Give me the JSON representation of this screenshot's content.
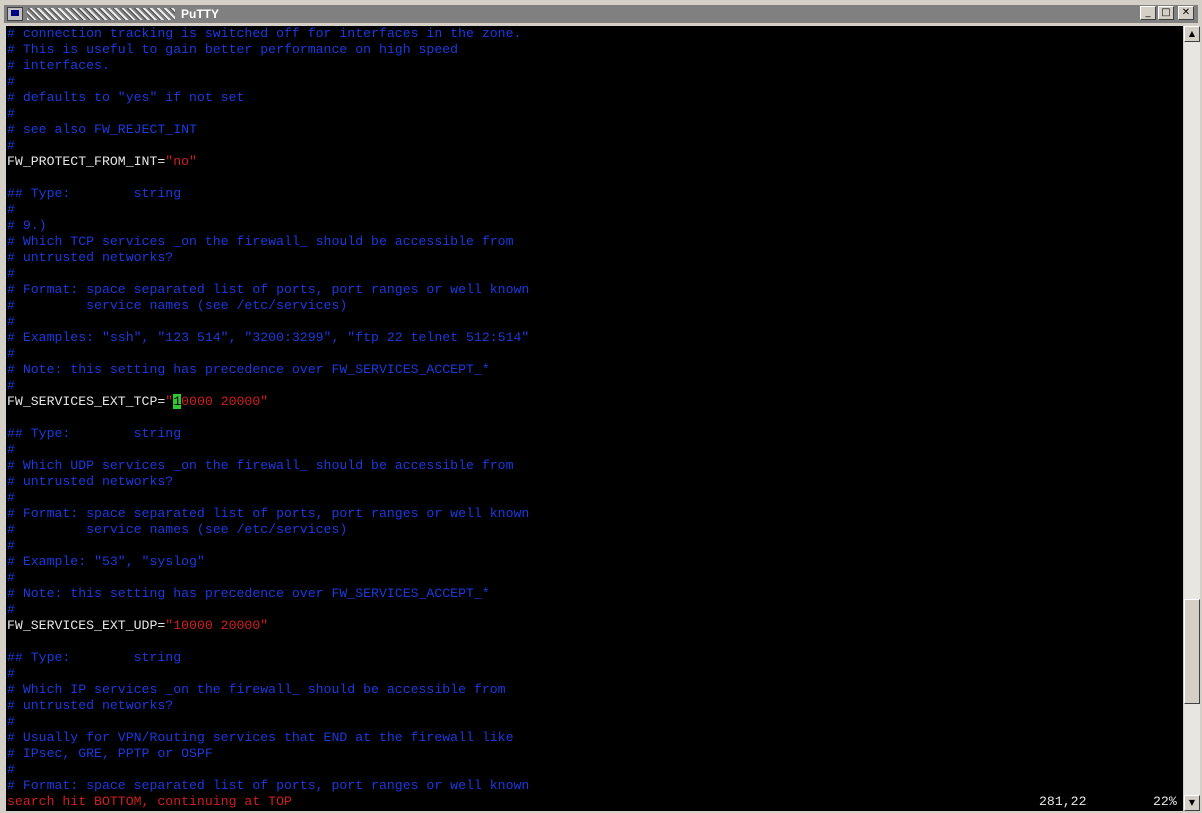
{
  "window": {
    "title": "PuTTY",
    "minimize": "_",
    "maximize": "□",
    "close": "✕"
  },
  "terminal": {
    "lines": [
      [
        {
          "t": "# connection tracking is switched off for interfaces in the zone.",
          "c": "c"
        }
      ],
      [
        {
          "t": "# This is useful to gain better performance on high speed",
          "c": "c"
        }
      ],
      [
        {
          "t": "# interfaces.",
          "c": "c"
        }
      ],
      [
        {
          "t": "#",
          "c": "c"
        }
      ],
      [
        {
          "t": "# defaults to \"yes\" if not set",
          "c": "c"
        }
      ],
      [
        {
          "t": "#",
          "c": "c"
        }
      ],
      [
        {
          "t": "# see also FW_REJECT_INT",
          "c": "c"
        }
      ],
      [
        {
          "t": "#",
          "c": "c"
        }
      ],
      [
        {
          "t": "FW_PROTECT_FROM_INT=",
          "c": "w"
        },
        {
          "t": "\"no\"",
          "c": "r"
        }
      ],
      [],
      [
        {
          "t": "## Type:        string",
          "c": "c"
        }
      ],
      [
        {
          "t": "#",
          "c": "c"
        }
      ],
      [
        {
          "t": "# 9.)",
          "c": "c"
        }
      ],
      [
        {
          "t": "# Which TCP services _on the firewall_ should be accessible from",
          "c": "c"
        }
      ],
      [
        {
          "t": "# untrusted networks?",
          "c": "c"
        }
      ],
      [
        {
          "t": "#",
          "c": "c"
        }
      ],
      [
        {
          "t": "# Format: space separated list of ports, port ranges or well known",
          "c": "c"
        }
      ],
      [
        {
          "t": "#         service names (see /etc/services)",
          "c": "c"
        }
      ],
      [
        {
          "t": "#",
          "c": "c"
        }
      ],
      [
        {
          "t": "# Examples: \"ssh\", \"123 514\", \"3200:3299\", \"ftp 22 telnet 512:514\"",
          "c": "c"
        }
      ],
      [
        {
          "t": "#",
          "c": "c"
        }
      ],
      [
        {
          "t": "# Note: this setting has precedence over FW_SERVICES_ACCEPT_*",
          "c": "c"
        }
      ],
      [
        {
          "t": "#",
          "c": "c"
        }
      ],
      [
        {
          "t": "FW_SERVICES_EXT_TCP=",
          "c": "w"
        },
        {
          "t": "\"",
          "c": "r"
        },
        {
          "t": "1",
          "c": "cursor"
        },
        {
          "t": "0000 20000\"",
          "c": "r"
        }
      ],
      [],
      [
        {
          "t": "## Type:        string",
          "c": "c"
        }
      ],
      [
        {
          "t": "#",
          "c": "c"
        }
      ],
      [
        {
          "t": "# Which UDP services _on the firewall_ should be accessible from",
          "c": "c"
        }
      ],
      [
        {
          "t": "# untrusted networks?",
          "c": "c"
        }
      ],
      [
        {
          "t": "#",
          "c": "c"
        }
      ],
      [
        {
          "t": "# Format: space separated list of ports, port ranges or well known",
          "c": "c"
        }
      ],
      [
        {
          "t": "#         service names (see /etc/services)",
          "c": "c"
        }
      ],
      [
        {
          "t": "#",
          "c": "c"
        }
      ],
      [
        {
          "t": "# Example: \"53\", \"syslog\"",
          "c": "c"
        }
      ],
      [
        {
          "t": "#",
          "c": "c"
        }
      ],
      [
        {
          "t": "# Note: this setting has precedence over FW_SERVICES_ACCEPT_*",
          "c": "c"
        }
      ],
      [
        {
          "t": "#",
          "c": "c"
        }
      ],
      [
        {
          "t": "FW_SERVICES_EXT_UDP=",
          "c": "w"
        },
        {
          "t": "\"10000 20000\"",
          "c": "r"
        }
      ],
      [],
      [
        {
          "t": "## Type:        string",
          "c": "c"
        }
      ],
      [
        {
          "t": "#",
          "c": "c"
        }
      ],
      [
        {
          "t": "# Which IP services _on the firewall_ should be accessible from",
          "c": "c"
        }
      ],
      [
        {
          "t": "# untrusted networks?",
          "c": "c"
        }
      ],
      [
        {
          "t": "#",
          "c": "c"
        }
      ],
      [
        {
          "t": "# Usually for VPN/Routing services that END at the firewall like",
          "c": "c"
        }
      ],
      [
        {
          "t": "# IPsec, GRE, PPTP or OSPF",
          "c": "c"
        }
      ],
      [
        {
          "t": "#",
          "c": "c"
        }
      ],
      [
        {
          "t": "# Format: space separated list of ports, port ranges or well known",
          "c": "c"
        }
      ]
    ]
  },
  "status": {
    "message": "search hit BOTTOM, continuing at TOP",
    "position": "281,22",
    "percent": "22%"
  },
  "scroll": {
    "position_fraction": 0.86,
    "visible_fraction": 0.14
  },
  "colors": {
    "comment": "#1a3ae0",
    "text": "#e6e6e6",
    "string": "#d21e1e",
    "cursor": "#2dc92d",
    "background": "#000000"
  }
}
